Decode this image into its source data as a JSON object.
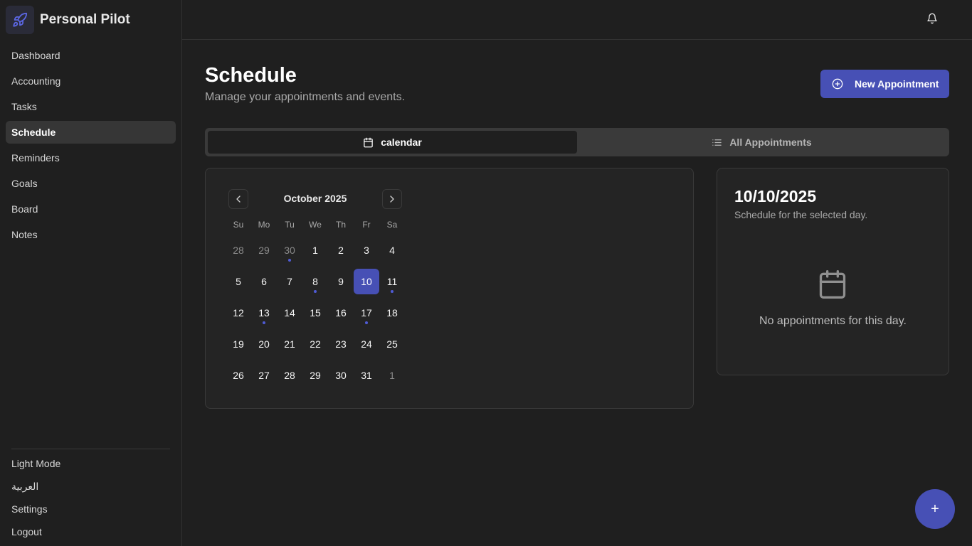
{
  "brand": {
    "name": "Personal Pilot",
    "logo_icon": "rocket-icon"
  },
  "sidebar": {
    "items": [
      {
        "label": "Dashboard",
        "active": false
      },
      {
        "label": "Accounting",
        "active": false
      },
      {
        "label": "Tasks",
        "active": false
      },
      {
        "label": "Schedule",
        "active": true
      },
      {
        "label": "Reminders",
        "active": false
      },
      {
        "label": "Goals",
        "active": false
      },
      {
        "label": "Board",
        "active": false
      },
      {
        "label": "Notes",
        "active": false
      }
    ],
    "bottom": [
      {
        "label": "Light Mode"
      },
      {
        "label": "العربية"
      },
      {
        "label": "Settings"
      },
      {
        "label": "Logout"
      }
    ]
  },
  "header": {
    "notification_icon": "bell-icon"
  },
  "page": {
    "title": "Schedule",
    "subtitle": "Manage your appointments and events.",
    "new_button": "New Appointment"
  },
  "tabs": [
    {
      "label": "calendar",
      "icon": "calendar-icon",
      "active": true
    },
    {
      "label": "All Appointments",
      "icon": "list-icon",
      "active": false
    }
  ],
  "calendar": {
    "month_label": "October 2025",
    "weekdays": [
      "Su",
      "Mo",
      "Tu",
      "We",
      "Th",
      "Fr",
      "Sa"
    ],
    "weeks": [
      [
        {
          "d": "28",
          "out": true
        },
        {
          "d": "29",
          "out": true
        },
        {
          "d": "30",
          "out": true,
          "dot": true
        },
        {
          "d": "1"
        },
        {
          "d": "2"
        },
        {
          "d": "3"
        },
        {
          "d": "4"
        }
      ],
      [
        {
          "d": "5"
        },
        {
          "d": "6"
        },
        {
          "d": "7"
        },
        {
          "d": "8",
          "dot": true
        },
        {
          "d": "9"
        },
        {
          "d": "10",
          "sel": true
        },
        {
          "d": "11",
          "dot": true
        }
      ],
      [
        {
          "d": "12"
        },
        {
          "d": "13",
          "dot": true
        },
        {
          "d": "14"
        },
        {
          "d": "15"
        },
        {
          "d": "16"
        },
        {
          "d": "17",
          "dot": true
        },
        {
          "d": "18"
        }
      ],
      [
        {
          "d": "19"
        },
        {
          "d": "20"
        },
        {
          "d": "21"
        },
        {
          "d": "22"
        },
        {
          "d": "23"
        },
        {
          "d": "24"
        },
        {
          "d": "25"
        }
      ],
      [
        {
          "d": "26"
        },
        {
          "d": "27"
        },
        {
          "d": "28"
        },
        {
          "d": "29"
        },
        {
          "d": "30"
        },
        {
          "d": "31"
        },
        {
          "d": "1",
          "out": true
        }
      ]
    ]
  },
  "day_panel": {
    "date": "10/10/2025",
    "subtitle": "Schedule for the selected day.",
    "empty_text": "No appointments for this day."
  },
  "fab": {
    "label": "+"
  },
  "colors": {
    "accent": "#4750b5",
    "background": "#1f1f1f",
    "card": "#242424"
  }
}
